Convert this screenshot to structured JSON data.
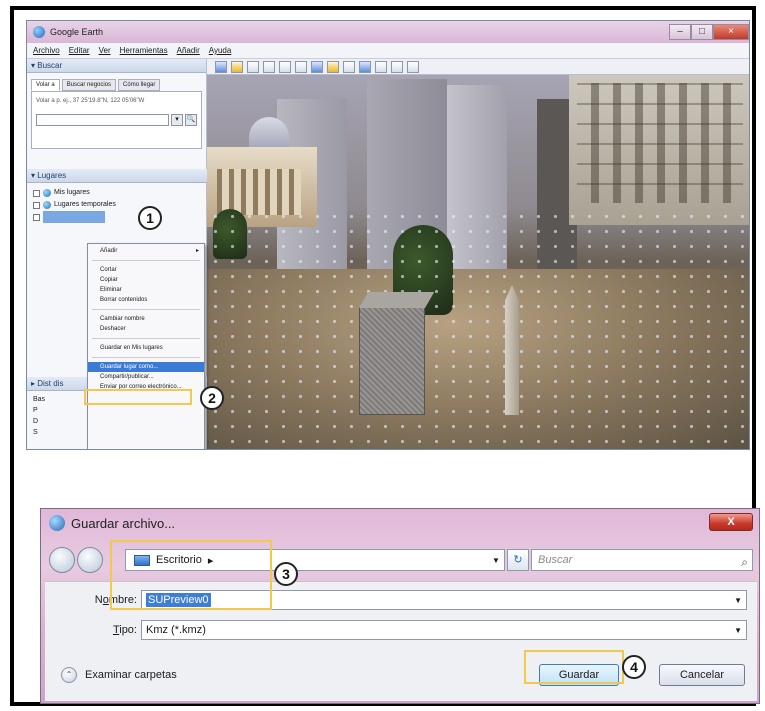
{
  "google_earth": {
    "title": "Google Earth",
    "menu": [
      "Archivo",
      "Editar",
      "Ver",
      "Herramientas",
      "Añadir",
      "Ayuda"
    ],
    "search_panel": {
      "header": "▾ Buscar",
      "tabs": [
        "Volar a",
        "Buscar negocios",
        "Cómo llegar"
      ],
      "hint": "Volar a p. ej., 37 25'19.8\"N, 122 05'06\"W",
      "go": "🔍"
    },
    "places_panel": {
      "header": "▾ Lugares",
      "items": [
        "Mis lugares",
        "Lugares temporales"
      ]
    },
    "layers_panel": {
      "header": "▸ Dist dis",
      "items": [
        "Bas",
        "P",
        "D",
        "S"
      ]
    },
    "context_menu": {
      "items": [
        "Añadir",
        "Cortar",
        "Copiar",
        "Eliminar",
        "Borrar contenidos",
        "Cambiar nombre",
        "Deshacer",
        "Guardar en Mis lugares",
        "Guardar lugar como...",
        "Compartir/publicar...",
        "Enviar por correo electrónico..."
      ],
      "submenu_arrow": "▸",
      "highlighted_index": 8
    }
  },
  "callouts": [
    "1",
    "2",
    "3",
    "4"
  ],
  "save_dialog": {
    "title": "Guardar archivo...",
    "close": "X",
    "path": "Escritorio",
    "path_arrow": "▸",
    "dropdown": "▼",
    "refresh": "↻",
    "search_placeholder": "Buscar",
    "search_icon": "⌕",
    "name_label_pre": "N",
    "name_label_ul": "o",
    "name_label_post": "mbre:",
    "name_value": "SUPreview0",
    "type_label_ul": "T",
    "type_label_post": "ipo:",
    "type_value": "Kmz (*.kmz)",
    "browse_label": "Examinar carpetas",
    "browse_icon": "⌃",
    "save_button": "Guardar",
    "cancel_button": "Cancelar"
  },
  "colors": {
    "highlight": "#f1c94c",
    "selection": "#3d7ed8"
  }
}
